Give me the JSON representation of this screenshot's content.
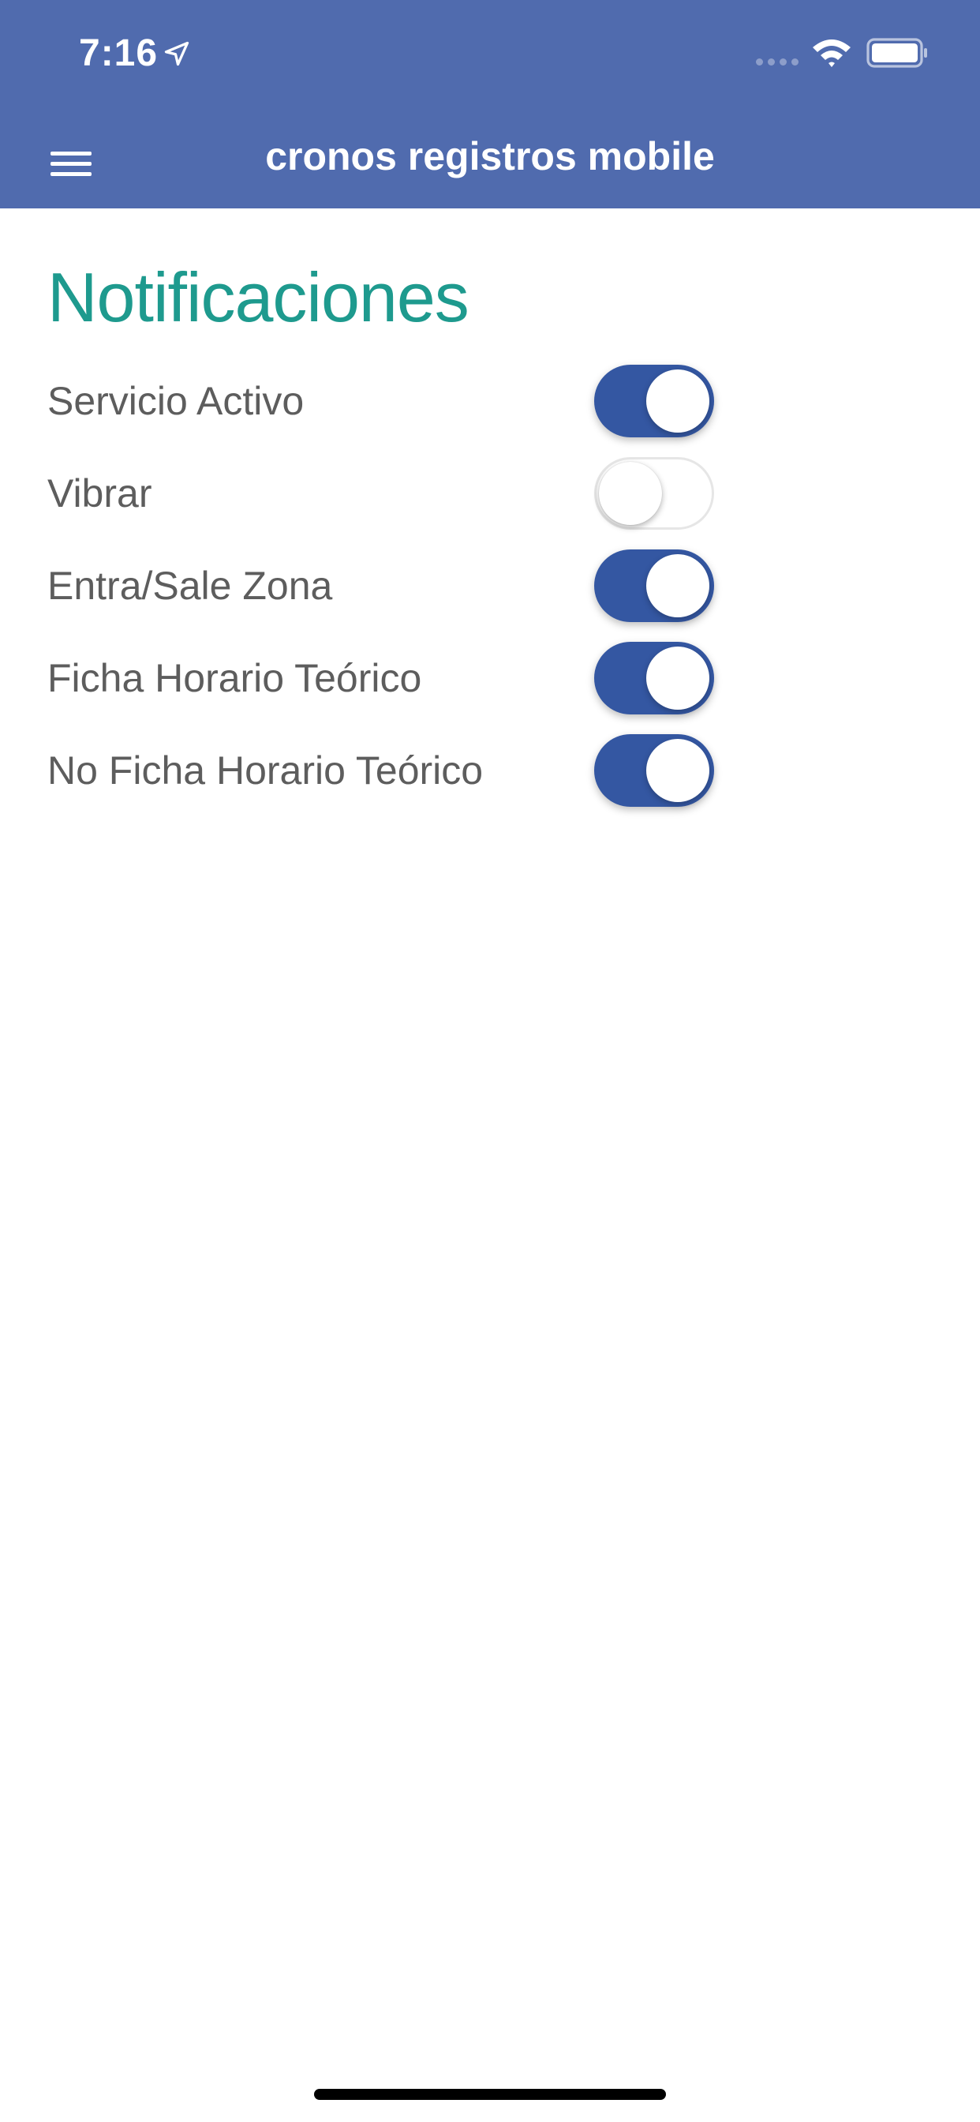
{
  "status_bar": {
    "time": "7:16",
    "icons": [
      "location-arrow-icon",
      "signal-icon",
      "wifi-icon",
      "battery-icon"
    ]
  },
  "header": {
    "title": "cronos registros mobile",
    "menu_icon": "hamburger-menu-icon",
    "background": "#506bae"
  },
  "notifications": {
    "title": "Notificaciones",
    "title_color": "#1e9a8e",
    "items": [
      {
        "label": "Servicio Activo",
        "enabled": true
      },
      {
        "label": "Vibrar",
        "enabled": false
      },
      {
        "label": "Entra/Sale Zona",
        "enabled": true
      },
      {
        "label": "Ficha Horario Teórico",
        "enabled": true
      },
      {
        "label": "No Ficha Horario Teórico",
        "enabled": true
      }
    ]
  },
  "colors": {
    "toggle_on": "#3457a2",
    "toggle_off": "#ffffff",
    "label_text": "#5d5d5d"
  }
}
